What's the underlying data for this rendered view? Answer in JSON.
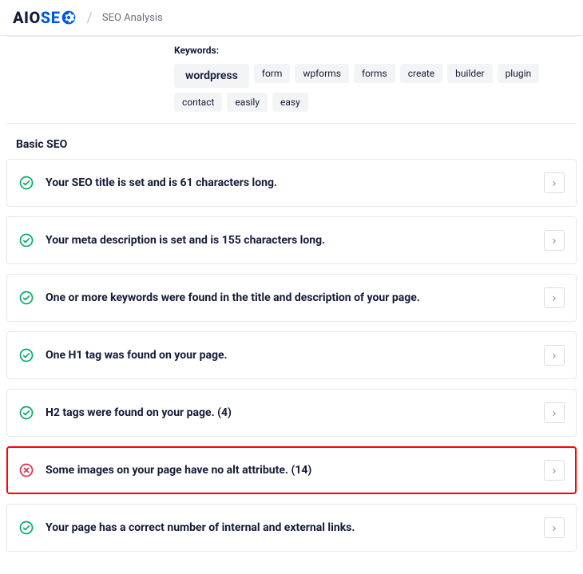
{
  "header": {
    "logo_aio": "AIO",
    "logo_se": "SE",
    "breadcrumb": "SEO Analysis"
  },
  "keywords": {
    "label": "Keywords:",
    "primary": "wordpress",
    "tags": [
      "form",
      "wpforms",
      "forms",
      "create",
      "builder",
      "plugin",
      "contact",
      "easily",
      "easy"
    ]
  },
  "section_title": "Basic SEO",
  "checks": [
    {
      "status": "ok",
      "message": "Your SEO title is set and is 61 characters long.",
      "highlight": false
    },
    {
      "status": "ok",
      "message": "Your meta description is set and is 155 characters long.",
      "highlight": false
    },
    {
      "status": "ok",
      "message": "One or more keywords were found in the title and description of your page.",
      "highlight": false
    },
    {
      "status": "ok",
      "message": "One H1 tag was found on your page.",
      "highlight": false
    },
    {
      "status": "ok",
      "message": "H2 tags were found on your page. (4)",
      "highlight": false
    },
    {
      "status": "error",
      "message": "Some images on your page have no alt attribute. (14)",
      "highlight": true
    },
    {
      "status": "ok",
      "message": "Your page has a correct number of internal and external links.",
      "highlight": false
    }
  ]
}
